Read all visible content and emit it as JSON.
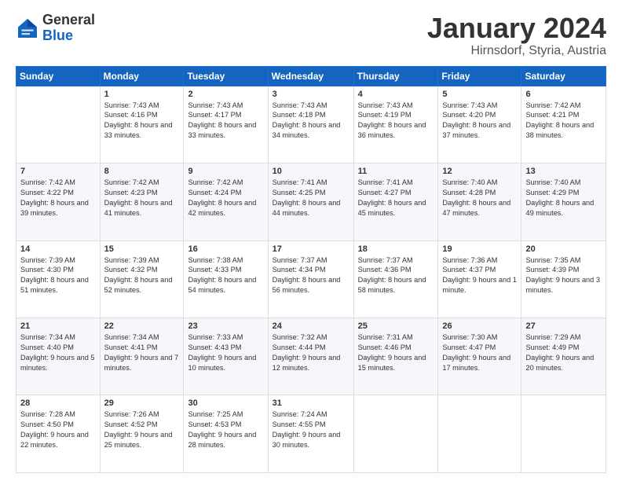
{
  "header": {
    "logo_general": "General",
    "logo_blue": "Blue",
    "month_title": "January 2024",
    "subtitle": "Hirnsdorf, Styria, Austria"
  },
  "columns": [
    "Sunday",
    "Monday",
    "Tuesday",
    "Wednesday",
    "Thursday",
    "Friday",
    "Saturday"
  ],
  "weeks": [
    [
      {
        "day": "",
        "sunrise": "",
        "sunset": "",
        "daylight": ""
      },
      {
        "day": "1",
        "sunrise": "Sunrise: 7:43 AM",
        "sunset": "Sunset: 4:16 PM",
        "daylight": "Daylight: 8 hours and 33 minutes."
      },
      {
        "day": "2",
        "sunrise": "Sunrise: 7:43 AM",
        "sunset": "Sunset: 4:17 PM",
        "daylight": "Daylight: 8 hours and 33 minutes."
      },
      {
        "day": "3",
        "sunrise": "Sunrise: 7:43 AM",
        "sunset": "Sunset: 4:18 PM",
        "daylight": "Daylight: 8 hours and 34 minutes."
      },
      {
        "day": "4",
        "sunrise": "Sunrise: 7:43 AM",
        "sunset": "Sunset: 4:19 PM",
        "daylight": "Daylight: 8 hours and 36 minutes."
      },
      {
        "day": "5",
        "sunrise": "Sunrise: 7:43 AM",
        "sunset": "Sunset: 4:20 PM",
        "daylight": "Daylight: 8 hours and 37 minutes."
      },
      {
        "day": "6",
        "sunrise": "Sunrise: 7:42 AM",
        "sunset": "Sunset: 4:21 PM",
        "daylight": "Daylight: 8 hours and 38 minutes."
      }
    ],
    [
      {
        "day": "7",
        "sunrise": "Sunrise: 7:42 AM",
        "sunset": "Sunset: 4:22 PM",
        "daylight": "Daylight: 8 hours and 39 minutes."
      },
      {
        "day": "8",
        "sunrise": "Sunrise: 7:42 AM",
        "sunset": "Sunset: 4:23 PM",
        "daylight": "Daylight: 8 hours and 41 minutes."
      },
      {
        "day": "9",
        "sunrise": "Sunrise: 7:42 AM",
        "sunset": "Sunset: 4:24 PM",
        "daylight": "Daylight: 8 hours and 42 minutes."
      },
      {
        "day": "10",
        "sunrise": "Sunrise: 7:41 AM",
        "sunset": "Sunset: 4:25 PM",
        "daylight": "Daylight: 8 hours and 44 minutes."
      },
      {
        "day": "11",
        "sunrise": "Sunrise: 7:41 AM",
        "sunset": "Sunset: 4:27 PM",
        "daylight": "Daylight: 8 hours and 45 minutes."
      },
      {
        "day": "12",
        "sunrise": "Sunrise: 7:40 AM",
        "sunset": "Sunset: 4:28 PM",
        "daylight": "Daylight: 8 hours and 47 minutes."
      },
      {
        "day": "13",
        "sunrise": "Sunrise: 7:40 AM",
        "sunset": "Sunset: 4:29 PM",
        "daylight": "Daylight: 8 hours and 49 minutes."
      }
    ],
    [
      {
        "day": "14",
        "sunrise": "Sunrise: 7:39 AM",
        "sunset": "Sunset: 4:30 PM",
        "daylight": "Daylight: 8 hours and 51 minutes."
      },
      {
        "day": "15",
        "sunrise": "Sunrise: 7:39 AM",
        "sunset": "Sunset: 4:32 PM",
        "daylight": "Daylight: 8 hours and 52 minutes."
      },
      {
        "day": "16",
        "sunrise": "Sunrise: 7:38 AM",
        "sunset": "Sunset: 4:33 PM",
        "daylight": "Daylight: 8 hours and 54 minutes."
      },
      {
        "day": "17",
        "sunrise": "Sunrise: 7:37 AM",
        "sunset": "Sunset: 4:34 PM",
        "daylight": "Daylight: 8 hours and 56 minutes."
      },
      {
        "day": "18",
        "sunrise": "Sunrise: 7:37 AM",
        "sunset": "Sunset: 4:36 PM",
        "daylight": "Daylight: 8 hours and 58 minutes."
      },
      {
        "day": "19",
        "sunrise": "Sunrise: 7:36 AM",
        "sunset": "Sunset: 4:37 PM",
        "daylight": "Daylight: 9 hours and 1 minute."
      },
      {
        "day": "20",
        "sunrise": "Sunrise: 7:35 AM",
        "sunset": "Sunset: 4:39 PM",
        "daylight": "Daylight: 9 hours and 3 minutes."
      }
    ],
    [
      {
        "day": "21",
        "sunrise": "Sunrise: 7:34 AM",
        "sunset": "Sunset: 4:40 PM",
        "daylight": "Daylight: 9 hours and 5 minutes."
      },
      {
        "day": "22",
        "sunrise": "Sunrise: 7:34 AM",
        "sunset": "Sunset: 4:41 PM",
        "daylight": "Daylight: 9 hours and 7 minutes."
      },
      {
        "day": "23",
        "sunrise": "Sunrise: 7:33 AM",
        "sunset": "Sunset: 4:43 PM",
        "daylight": "Daylight: 9 hours and 10 minutes."
      },
      {
        "day": "24",
        "sunrise": "Sunrise: 7:32 AM",
        "sunset": "Sunset: 4:44 PM",
        "daylight": "Daylight: 9 hours and 12 minutes."
      },
      {
        "day": "25",
        "sunrise": "Sunrise: 7:31 AM",
        "sunset": "Sunset: 4:46 PM",
        "daylight": "Daylight: 9 hours and 15 minutes."
      },
      {
        "day": "26",
        "sunrise": "Sunrise: 7:30 AM",
        "sunset": "Sunset: 4:47 PM",
        "daylight": "Daylight: 9 hours and 17 minutes."
      },
      {
        "day": "27",
        "sunrise": "Sunrise: 7:29 AM",
        "sunset": "Sunset: 4:49 PM",
        "daylight": "Daylight: 9 hours and 20 minutes."
      }
    ],
    [
      {
        "day": "28",
        "sunrise": "Sunrise: 7:28 AM",
        "sunset": "Sunset: 4:50 PM",
        "daylight": "Daylight: 9 hours and 22 minutes."
      },
      {
        "day": "29",
        "sunrise": "Sunrise: 7:26 AM",
        "sunset": "Sunset: 4:52 PM",
        "daylight": "Daylight: 9 hours and 25 minutes."
      },
      {
        "day": "30",
        "sunrise": "Sunrise: 7:25 AM",
        "sunset": "Sunset: 4:53 PM",
        "daylight": "Daylight: 9 hours and 28 minutes."
      },
      {
        "day": "31",
        "sunrise": "Sunrise: 7:24 AM",
        "sunset": "Sunset: 4:55 PM",
        "daylight": "Daylight: 9 hours and 30 minutes."
      },
      {
        "day": "",
        "sunrise": "",
        "sunset": "",
        "daylight": ""
      },
      {
        "day": "",
        "sunrise": "",
        "sunset": "",
        "daylight": ""
      },
      {
        "day": "",
        "sunrise": "",
        "sunset": "",
        "daylight": ""
      }
    ]
  ]
}
